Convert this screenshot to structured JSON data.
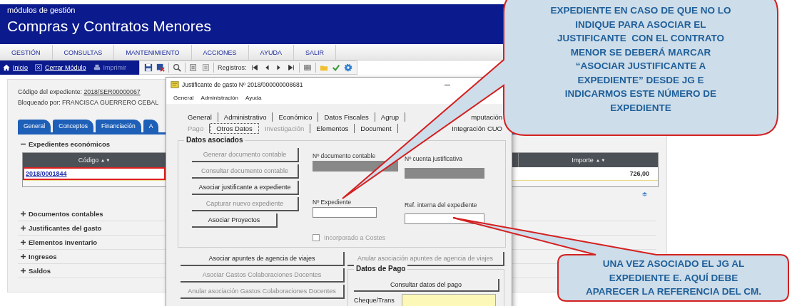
{
  "header": {
    "subtitle": "módulos de gestión",
    "title": "Compras y Contratos Menores"
  },
  "menu": [
    "GESTIÓN",
    "CONSULTAS",
    "MANTENIMIENTO",
    "ACCIONES",
    "AYUDA",
    "SALIR"
  ],
  "toolbar": {
    "links": [
      {
        "kind": "home",
        "label": "Inicio",
        "disabled": false
      },
      {
        "kind": "close",
        "label": "Cerrar Módulo",
        "disabled": false
      },
      {
        "kind": "print",
        "label": "Imprimir",
        "disabled": true
      }
    ],
    "records_label": "Registros:"
  },
  "record": {
    "code_label": "Código del expediente:",
    "code": "2018/SER00000067",
    "locked": "Bloqueado por: FRANCISCA GUERRERO CEBAL"
  },
  "tabs": [
    "General",
    "Conceptos",
    "Financiación",
    "A"
  ],
  "sections": [
    {
      "label": "Expedientes económicos",
      "expanded": true
    },
    {
      "label": "Documentos contables",
      "expanded": false
    },
    {
      "label": "Justificantes del gasto",
      "expanded": false
    },
    {
      "label": "Elementos inventario",
      "expanded": false
    },
    {
      "label": "Ingresos",
      "expanded": false
    },
    {
      "label": "Saldos",
      "expanded": false
    }
  ],
  "table": {
    "columns": [
      "Código",
      "Importe"
    ],
    "rows": [
      {
        "cells": [
          "2018/0001844",
          "726,00"
        ],
        "highlighted": true
      }
    ]
  },
  "dialog": {
    "title": "Justificante de gasto Nº 2018/000000008681",
    "menu": [
      "General",
      "Administración",
      "Ayuda"
    ],
    "tab_rows": [
      [
        {
          "label": "General",
          "selected": false,
          "disabled": false
        },
        {
          "label": "Administrativo",
          "selected": false,
          "disabled": false
        },
        {
          "label": "Económico",
          "selected": false,
          "disabled": false
        },
        {
          "label": "Datos Fiscales",
          "selected": false,
          "disabled": false
        },
        {
          "label": "Agrup",
          "selected": false,
          "disabled": false
        },
        {
          "label": "mputación",
          "selected": false,
          "disabled": false
        }
      ],
      [
        {
          "label": "Pago",
          "selected": false,
          "disabled": true
        },
        {
          "label": "Otros Datos",
          "selected": true,
          "disabled": false
        },
        {
          "label": "Investigación",
          "selected": false,
          "disabled": true
        },
        {
          "label": "Elementos",
          "selected": false,
          "disabled": false
        },
        {
          "label": "Document",
          "selected": false,
          "disabled": false
        },
        {
          "label": "Integración CUO",
          "selected": false,
          "disabled": false
        }
      ]
    ],
    "group": {
      "title": "Datos asociados",
      "buttons": [
        {
          "label": "Generar documento contable",
          "disabled": true
        },
        {
          "label": "Consultar documento contable",
          "disabled": true
        },
        {
          "label": "Asociar justificante a expediente",
          "disabled": false
        },
        {
          "label": "Capturar nuevo expediente",
          "disabled": true
        },
        {
          "label": "Asociar Proyectos",
          "disabled": false
        }
      ],
      "fields": [
        {
          "label": "Nº documento contable",
          "disabled": true
        },
        {
          "label": "Nº cuenta justificativa",
          "disabled": true
        },
        {
          "label": "Nº Expediente",
          "disabled": false
        },
        {
          "label": "Ref. interna del expediente",
          "disabled": false
        }
      ],
      "checkbox": {
        "label": "Incorporado a Costes",
        "checked": false,
        "disabled": true
      }
    },
    "left_buttons": [
      {
        "label": "Asociar apuntes de agencia de viajes",
        "disabled": false
      },
      {
        "label": "Asociar Gastos Colaboraciones Docentes",
        "disabled": true
      },
      {
        "label": "Anular asociación Gastos Colaboraciones Docentes",
        "disabled": true
      }
    ],
    "right_button": {
      "label": "Anular asociación apuntes de agencia de viajes",
      "disabled": true
    },
    "payment": {
      "title": "Datos de Pago",
      "button": "Consultar datos del pago",
      "field_label": "Cheque/Trans"
    }
  },
  "callouts": [
    {
      "text": "EXPEDIENTE EN CASO DE QUE NO LO\nINDIQUE PARA ASOCIAR EL\nJUSTIFICANTE  CON EL CONTRATO\nMENOR SE DEBERÁ MARCAR\n“ASOCIAR JUSTIFICANTE A\nEXPEDIENTE” DESDE JG E\nINDICARMOS ESTE NÚMERO DE\nEXPEDIENTE"
    },
    {
      "text": "UNA VEZ ASOCIADO EL JG AL\nEXPEDIENTE E. AQUÍ DEBE\nAPARECER LA REFERENCIA DEL CM."
    }
  ]
}
